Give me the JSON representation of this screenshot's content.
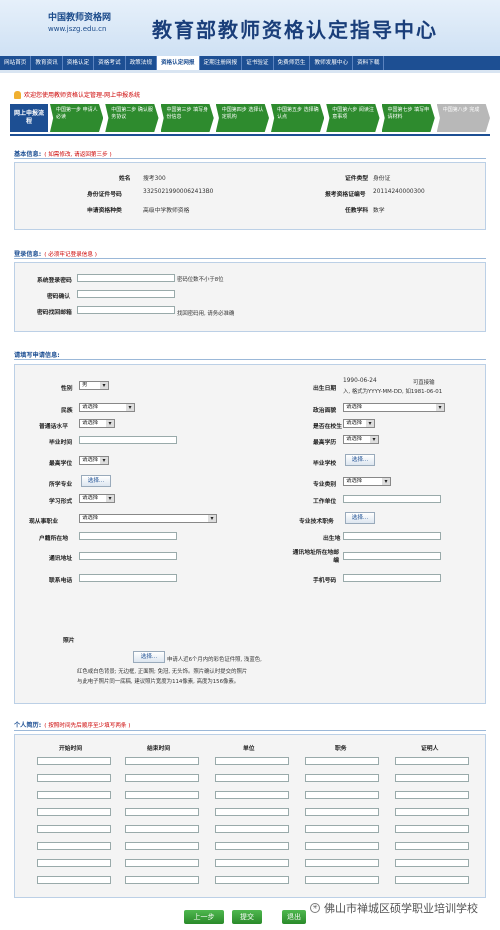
{
  "header": {
    "logo_cn": "中国教师资格网",
    "logo_url": "www.jszg.edu.cn",
    "title": "教育部教师资格认定指导中心"
  },
  "nav": [
    "网站首页",
    "教育资讯",
    "资格认定",
    "资格考试",
    "政策法规",
    "资格认定网报",
    "定期注册网报",
    "证书验证",
    "免费师范生",
    "教师发展中心",
    "资料下载"
  ],
  "welcome": "欢迎您使用教师资格认定管理-网上申报系统",
  "steps": {
    "first": "网上申报流程",
    "items": [
      "中国第一步 申请人必读",
      "中国第二步 确认服务协议",
      "中国第三步 填写身份信息",
      "中国第四步 选择认定机构",
      "中国第五步 选择确认点",
      "中国第六步 阅读注意事项",
      "中国第七步 填写申请材料",
      "中国第八步 完成"
    ]
  },
  "basic": {
    "title": "基本信息:",
    "note": "( 如需修改, 请返回第三步 )",
    "name_label": "姓名",
    "name_value": "搜考300",
    "idtype_label": "证件类型",
    "idtype_value": "身份证",
    "idno_label": "身份证件号码",
    "idno_value": "33250219900062413B0",
    "examno_label": "报考资格证编号",
    "examno_value": "20114240000300",
    "cert_label": "申请资格种类",
    "cert_value": "高级中学教师资格",
    "subject_label": "任教学科",
    "subject_value": "数学"
  },
  "login": {
    "title": "登录信息:",
    "note": "( 必须牢记登录信息 )",
    "pwd_label": "系统登录密码",
    "pwd_hint": "密码位数不小于8位",
    "confirm_label": "密码确认",
    "email_label": "密码找回邮箱",
    "email_hint": "找回密码用, 请务必准确"
  },
  "apply": {
    "title": "请填写申请信息:",
    "gender_label": "性别",
    "gender_value": "男",
    "birth_label": "出生日期",
    "birth_value": "1990-06-24",
    "birth_hint1": "可直接输",
    "birth_hint2": "入, 格式为YYYY-MM-DD, 如1981-06-01",
    "nation_label": "民族",
    "nation_value": "请选择",
    "politics_label": "政治面貌",
    "politics_value": "请选择",
    "mandarin_label": "普通话水平",
    "mandarin_value": "请选择",
    "inschool_label": "是否在校生",
    "inschool_value": "请选择",
    "gradtime_label": "毕业时间",
    "degree_label": "最高学历",
    "degree_value": "请选择",
    "topschool_label": "最高学位",
    "topschool_value": "请选择",
    "gradschool_label": "毕业学校",
    "gradschool_btn": "选择...",
    "major_label": "所学专业",
    "major_btn": "选择...",
    "majortype_label": "专业类别",
    "majortype_value": "请选择",
    "studyform_label": "学习形式",
    "studyform_value": "请选择",
    "workplace_label": "工作单位",
    "job_label": "现从事职业",
    "job_value": "请选择",
    "title_label": "专业技术职务",
    "title_btn": "选择...",
    "hukou_label": "户籍所在地",
    "birthplace_label": "出生地",
    "address_label": "通讯地址",
    "postcode_label": "通讯地址所在地邮编",
    "phone_label": "联系电话",
    "mobile_label": "手机号码",
    "photo_label": "照片",
    "photo_btn": "选择...",
    "photo_hint1": "申请人近6个月内的彩色证件照, 浅蓝色,",
    "photo_hint2": "红色或白色背景; 无边框, 正面照; 免冠, 无头饰。照片确认时提交的照片",
    "photo_hint3": "与此电子照片同一底稿, 建议照片宽度为114像素, 高度为156像素。"
  },
  "resume": {
    "title": "个人简历:",
    "note": "( 按照时间先后顺序至少填写两条 )",
    "headers": [
      "开始时间",
      "结束时间",
      "单位",
      "职务",
      "证明人"
    ],
    "rows": 8
  },
  "buttons": {
    "prev": "上一步",
    "submit": "提交",
    "exit": "退出"
  },
  "watermark": "佛山市禅城区硕学职业培训学校"
}
